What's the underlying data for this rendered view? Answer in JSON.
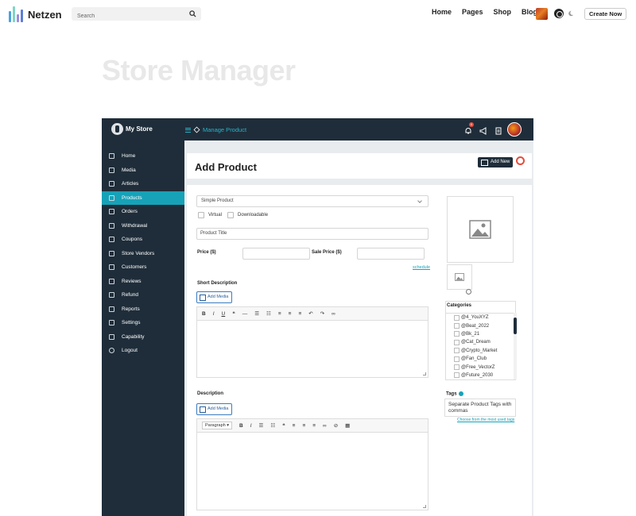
{
  "header": {
    "logo_text": "Netzen",
    "search_placeholder": "Search",
    "nav": [
      "Home",
      "Pages",
      "Shop",
      "Blog"
    ],
    "create_label": "Create Now"
  },
  "page_title": "Store Manager",
  "app": {
    "store_name": "My Store",
    "breadcrumb": "Manage Product",
    "notification_count": "0",
    "sidebar": [
      {
        "label": "Home",
        "active": false
      },
      {
        "label": "Media",
        "active": false
      },
      {
        "label": "Articles",
        "active": false
      },
      {
        "label": "Products",
        "active": true
      },
      {
        "label": "Orders",
        "active": false
      },
      {
        "label": "Withdrawal",
        "active": false
      },
      {
        "label": "Coupons",
        "active": false
      },
      {
        "label": "Store Vendors",
        "active": false
      },
      {
        "label": "Customers",
        "active": false
      },
      {
        "label": "Reviews",
        "active": false
      },
      {
        "label": "Refund",
        "active": false
      },
      {
        "label": "Reports",
        "active": false
      },
      {
        "label": "Settings",
        "active": false
      },
      {
        "label": "Capability",
        "active": false
      },
      {
        "label": "Logout",
        "active": false
      }
    ],
    "form": {
      "title": "Add Product",
      "add_new_label": "Add New",
      "product_type": "Simple Product",
      "virtual_label": "Virtual",
      "downloadable_label": "Downloadable",
      "title_placeholder": "Product Title",
      "price_label": "Price ($)",
      "sale_price_label": "Sale Price ($)",
      "schedule_label": "schedule",
      "short_desc_label": "Short Description",
      "add_media_label": "Add Media",
      "description_label": "Description",
      "paragraph_label": "Paragraph",
      "categories_label": "Categories",
      "categories": [
        "@4_YouXYZ",
        "@Beat_2022",
        "@Bk_21",
        "@Cat_Dream",
        "@Crypto_Market",
        "@Fan_Club",
        "@Free_VectorZ",
        "@Future_2030"
      ],
      "tags_label": "Tags",
      "tags_placeholder": "Separate Product Tags with commas",
      "tags_link": "Choose from the most used tags"
    }
  },
  "colors": {
    "sidebar_bg": "#1f2d3a",
    "accent": "#17a2b8",
    "title_faded": "#e8e8e8"
  }
}
